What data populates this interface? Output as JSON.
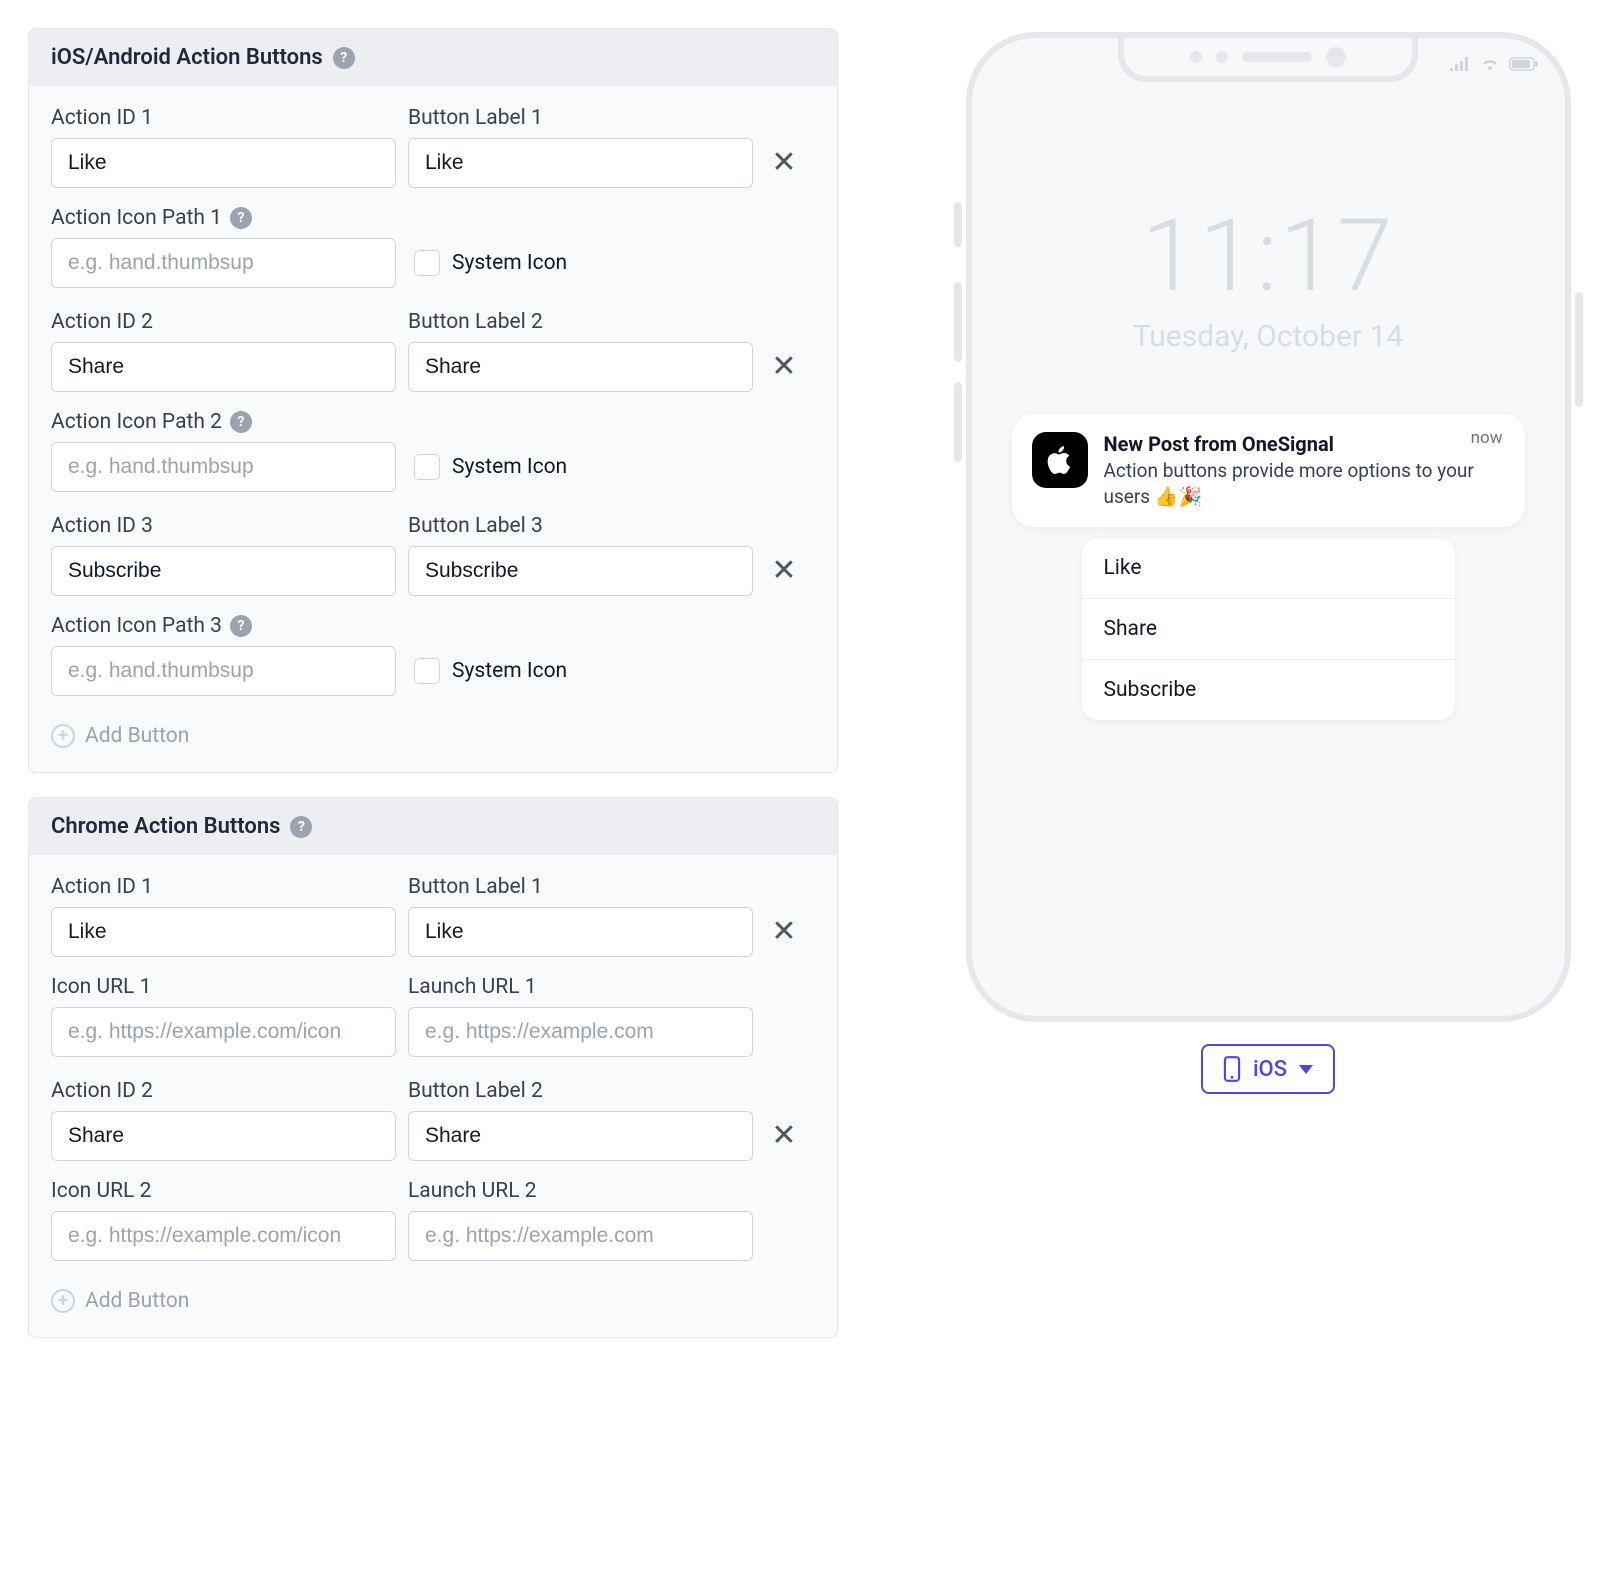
{
  "ios_android_panel": {
    "title": "iOS/Android Action Buttons",
    "rows": [
      {
        "action_id_label": "Action ID 1",
        "action_id_value": "Like",
        "button_label_label": "Button Label 1",
        "button_label_value": "Like",
        "icon_path_label": "Action Icon Path 1",
        "icon_path_placeholder": "e.g. hand.thumbsup",
        "system_icon_label": "System Icon"
      },
      {
        "action_id_label": "Action ID 2",
        "action_id_value": "Share",
        "button_label_label": "Button Label 2",
        "button_label_value": "Share",
        "icon_path_label": "Action Icon Path 2",
        "icon_path_placeholder": "e.g. hand.thumbsup",
        "system_icon_label": "System Icon"
      },
      {
        "action_id_label": "Action ID 3",
        "action_id_value": "Subscribe",
        "button_label_label": "Button Label 3",
        "button_label_value": "Subscribe",
        "icon_path_label": "Action Icon Path 3",
        "icon_path_placeholder": "e.g. hand.thumbsup",
        "system_icon_label": "System Icon"
      }
    ],
    "add_button_label": "Add Button"
  },
  "chrome_panel": {
    "title": "Chrome Action Buttons",
    "rows": [
      {
        "action_id_label": "Action ID 1",
        "action_id_value": "Like",
        "button_label_label": "Button Label 1",
        "button_label_value": "Like",
        "icon_url_label": "Icon URL 1",
        "icon_url_placeholder": "e.g. https://example.com/icon",
        "launch_url_label": "Launch URL 1",
        "launch_url_placeholder": "e.g. https://example.com"
      },
      {
        "action_id_label": "Action ID 2",
        "action_id_value": "Share",
        "button_label_label": "Button Label 2",
        "button_label_value": "Share",
        "icon_url_label": "Icon URL 2",
        "icon_url_placeholder": "e.g. https://example.com/icon",
        "launch_url_label": "Launch URL 2",
        "launch_url_placeholder": "e.g. https://example.com"
      }
    ],
    "add_button_label": "Add Button"
  },
  "preview": {
    "time": "11:17",
    "date": "Tuesday, October 14",
    "notif_title": "New Post from OneSignal",
    "notif_body": "Action buttons provide more options to your users 👍🎉",
    "notif_time": "now",
    "actions": [
      "Like",
      "Share",
      "Subscribe"
    ],
    "platform_label": "iOS"
  },
  "icons": {
    "help": "?",
    "close": "✕",
    "plus": "+"
  }
}
